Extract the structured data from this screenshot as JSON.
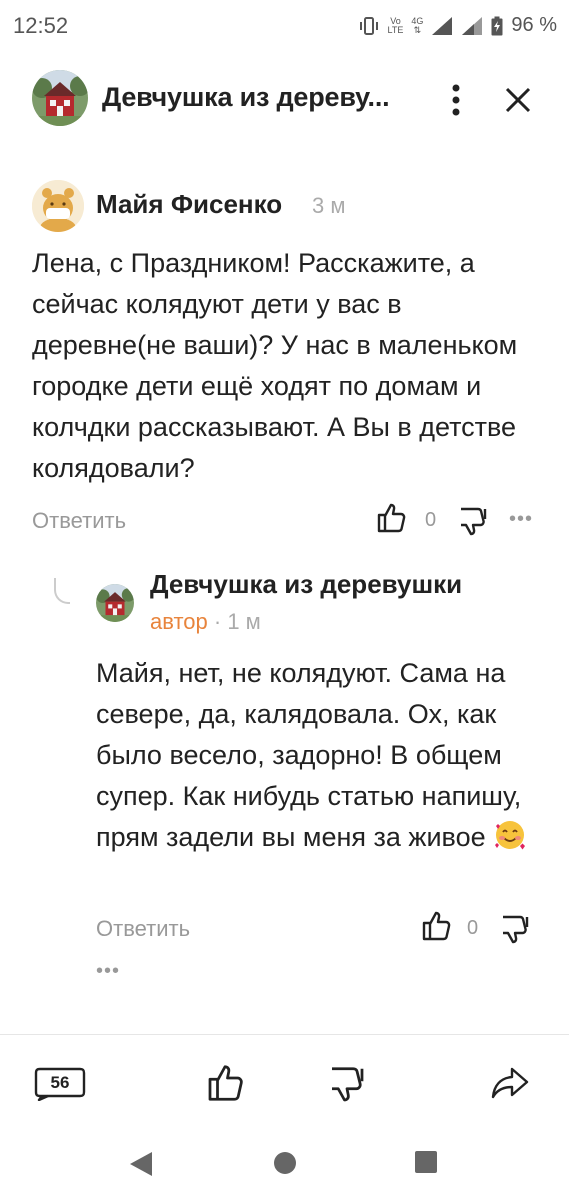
{
  "status_bar": {
    "time": "12:52",
    "network_top": "Vo",
    "network_bottom": "LTE",
    "network_4g": "4G",
    "battery": "96 %"
  },
  "header": {
    "title": "Девчушка из деревушки",
    "title_display": "Девчушка из дереву...",
    "menu_icon": "vertical-dots-icon",
    "close_icon": "close-icon"
  },
  "comment": {
    "author": "Майя Фисенко",
    "time": "3 м",
    "text": "Лена, с Праздником! Расскажите, а сейчас колядуют дети у вас в деревне(не ваши)? У нас в маленьком городке дети ещё ходят по домам и колчдки рассказывают. А Вы в детстве колядовали?",
    "reply_label": "Ответить",
    "likes": "0",
    "more": "•••"
  },
  "reply": {
    "author": "Девчушка из деревушки",
    "badge": "автор",
    "separator": " · ",
    "time": "1 м",
    "text": "Майя, нет, не колядуют. Сама на севере, да, калядовала. Ох, как было весело, задорно! В общем супер. Как нибудь статью напишу, прям задели вы меня за живое",
    "reply_label": "Ответить",
    "likes": "0",
    "more": "•••"
  },
  "bottom_bar": {
    "comments_count": "56",
    "like_icon": "thumbs-up-icon",
    "dislike_icon": "thumbs-down-icon",
    "share_icon": "share-arrow-icon"
  },
  "nav_bar": {
    "back_icon": "back-triangle-icon",
    "home_icon": "home-circle-icon",
    "recents_icon": "recents-square-icon"
  },
  "colors": {
    "author_badge": "#e8843c",
    "muted_text": "#999999",
    "main_text": "#222222"
  }
}
